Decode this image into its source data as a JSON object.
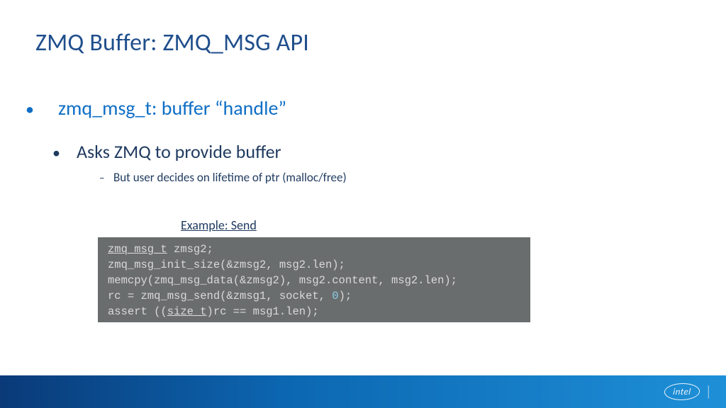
{
  "title": "ZMQ Buffer: ZMQ_MSG API",
  "bullets": {
    "lvl1": "zmq_msg_t: buffer “handle”",
    "lvl2": "Asks ZMQ to provide buffer",
    "lvl3": "But user decides on lifetime of ptr (malloc/free)"
  },
  "example_label": "Example: Send",
  "code": {
    "line1a": "zmq_msg_t",
    "line1b": " zmsg2;",
    "line2": "zmq_msg_init_size(&zmsg2, msg2.len);",
    "line3": "memcpy(zmq_msg_data(&zmsg2), msg2.content, msg2.len);",
    "line4a": "rc = zmq_msg_send(&zmsg1, socket, ",
    "line4b": "0",
    "line4c": ");",
    "line5a": "assert ((",
    "line5b": "size_t",
    "line5c": ")rc == msg1.len);"
  },
  "footer": {
    "brand": "intel"
  }
}
